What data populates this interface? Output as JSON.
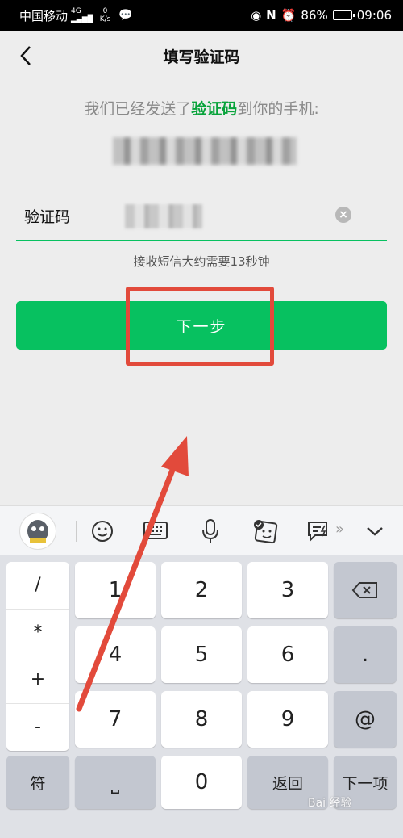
{
  "status_bar": {
    "carrier": "中国移动",
    "signal": "4G",
    "speed_value": "0",
    "speed_unit": "K/s",
    "battery": "86%",
    "battery_level": 0.86,
    "time": "09:06"
  },
  "header": {
    "title": "填写验证码"
  },
  "message": {
    "prefix": "我们已经发送了",
    "highlight": "验证码",
    "suffix": "到你的手机:"
  },
  "code_field": {
    "label": "验证码"
  },
  "hint": "接收短信大约需要13秒钟",
  "next_button": "下一步",
  "keyboard": {
    "symbols": [
      "/",
      "*",
      "+",
      "-"
    ],
    "digits": [
      "1",
      "2",
      "3",
      "4",
      "5",
      "6",
      "7",
      "8",
      "9"
    ],
    "dot": ".",
    "at": "@",
    "fu": "符",
    "space": "⎵",
    "zero": "0",
    "back": "返回",
    "next_item": "下一项",
    "toolbar_more": "»"
  },
  "watermark": "Bai 经验"
}
